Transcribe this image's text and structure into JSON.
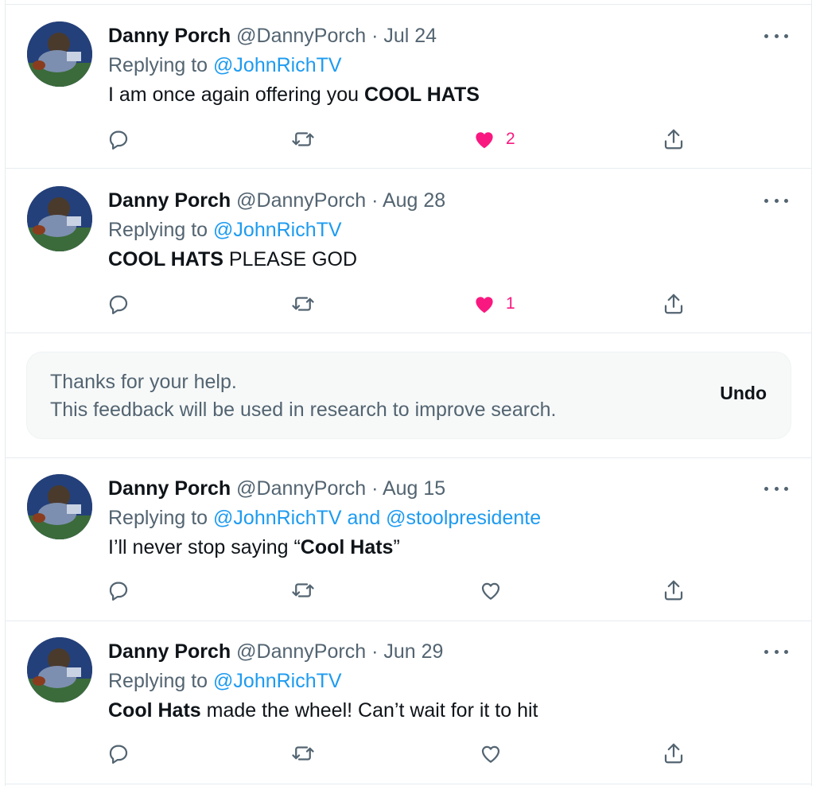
{
  "colors": {
    "like_active": "#f91880",
    "mention": "#1d9bf0",
    "muted_text": "#536471",
    "divider": "#e6ecf0"
  },
  "tweets": [
    {
      "name": "Danny Porch",
      "handle": "@DannyPorch",
      "separator": "·",
      "date": "Jul 24",
      "reply_prefix": "Replying to",
      "reply_to": "@JohnRichTV",
      "body_plain": "I am once again offering you ",
      "body_bold": "COOL HATS",
      "body_tail": "",
      "liked": true,
      "like_count": "2"
    },
    {
      "name": "Danny Porch",
      "handle": "@DannyPorch",
      "separator": "·",
      "date": "Aug 28",
      "reply_prefix": "Replying to",
      "reply_to": "@JohnRichTV",
      "body_bold": "COOL HATS",
      "body_plain": " PLEASE GOD",
      "liked": true,
      "like_count": "1"
    },
    {
      "name": "Danny Porch",
      "handle": "@DannyPorch",
      "separator": "·",
      "date": "Aug 15",
      "reply_prefix": "Replying to",
      "reply_to": "@JohnRichTV and @stoolpresidente",
      "body_plain": "I’ll never stop saying “",
      "body_bold": "Cool Hats",
      "body_tail": "”",
      "liked": false,
      "like_count": ""
    },
    {
      "name": "Danny Porch",
      "handle": "@DannyPorch",
      "separator": "·",
      "date": "Jun 29",
      "reply_prefix": "Replying to",
      "reply_to": "@JohnRichTV",
      "body_bold": "Cool Hats",
      "body_plain": " made the wheel! Can’t wait for it to hit",
      "liked": false,
      "like_count": ""
    }
  ],
  "feedback": {
    "line1": "Thanks for your help.",
    "line2": "This feedback will be used in research to improve search.",
    "undo_label": "Undo"
  },
  "icons": {
    "more": "more-horizontal-icon",
    "reply": "reply-bubble-icon",
    "retweet": "retweet-icon",
    "like": "heart-icon",
    "share": "share-upload-icon"
  }
}
